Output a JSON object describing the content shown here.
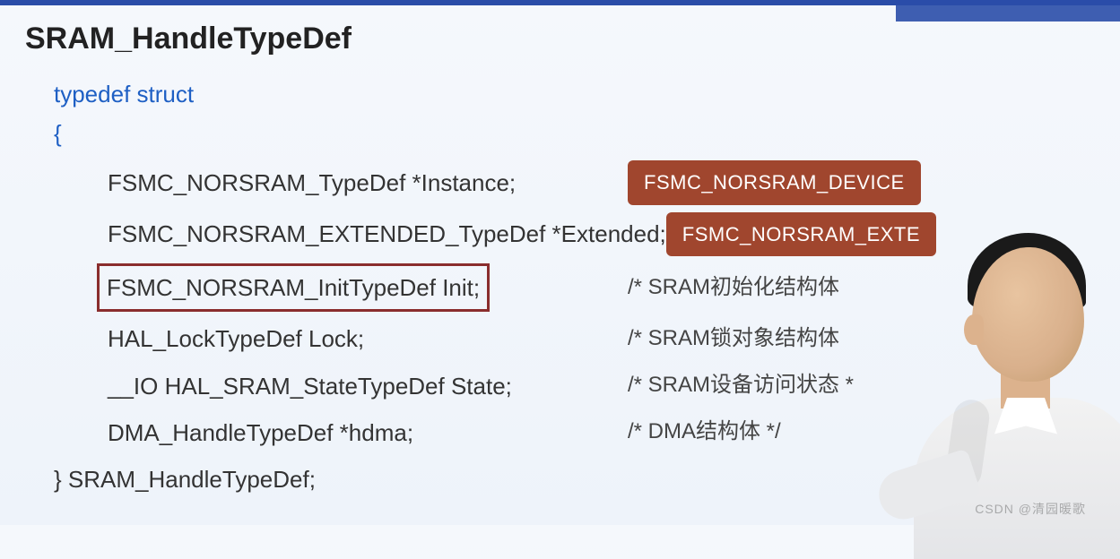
{
  "title": "SRAM_HandleTypeDef",
  "keywords": {
    "typedef_struct": "typedef struct",
    "open_brace": "{",
    "close_line": "} SRAM_HandleTypeDef;"
  },
  "members": [
    {
      "decl": "FSMC_NORSRAM_TypeDef *Instance;",
      "badge": "FSMC_NORSRAM_DEVICE",
      "comment": "",
      "highlighted": false
    },
    {
      "decl": "FSMC_NORSRAM_EXTENDED_TypeDef *Extended;",
      "badge": "FSMC_NORSRAM_EXTE",
      "comment": "",
      "highlighted": false
    },
    {
      "decl": "FSMC_NORSRAM_InitTypeDef Init;",
      "badge": "",
      "comment": "/* SRAM初始化结构体",
      "highlighted": true
    },
    {
      "decl": "HAL_LockTypeDef Lock;",
      "badge": "",
      "comment": "/* SRAM锁对象结构体",
      "highlighted": false
    },
    {
      "decl": "__IO HAL_SRAM_StateTypeDef State;",
      "badge": "",
      "comment": "/* SRAM设备访问状态 *",
      "highlighted": false
    },
    {
      "decl": "DMA_HandleTypeDef *hdma;",
      "badge": "",
      "comment": "/* DMA结构体 */",
      "highlighted": false
    }
  ],
  "watermark": "CSDN @清园暖歌"
}
